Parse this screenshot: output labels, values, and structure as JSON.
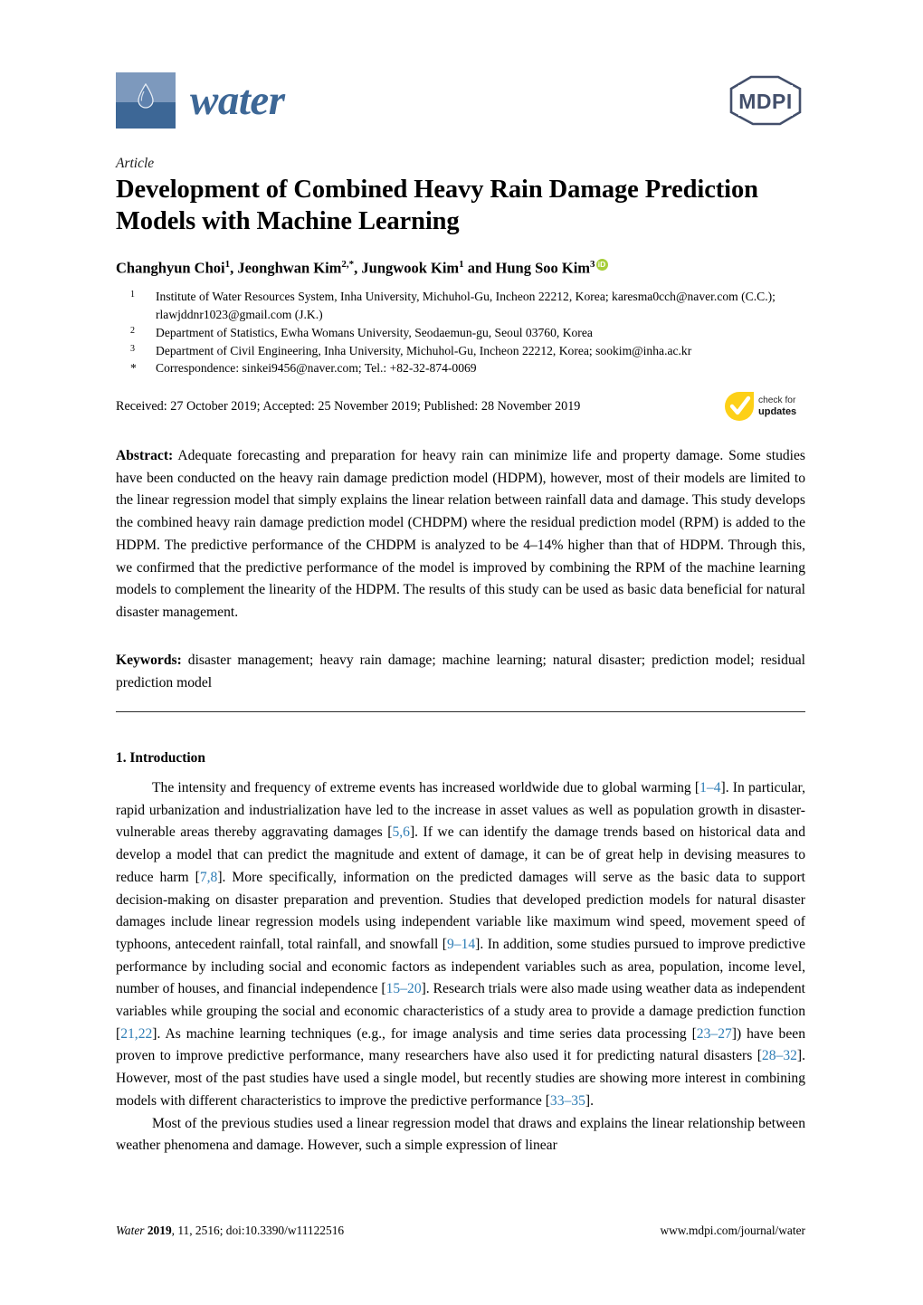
{
  "journal": {
    "name": "water",
    "logo_icon": "water-droplet-icon",
    "publisher_logo": "mdpi-logo"
  },
  "article": {
    "type": "Article",
    "title": "Development of Combined Heavy Rain Damage Prediction Models with Machine Learning"
  },
  "authors": {
    "line_parts": [
      {
        "name": "Changhyun Choi",
        "sup": "1"
      },
      {
        "name": "Jeonghwan Kim",
        "sup": "2,*"
      },
      {
        "name": "Jungwook Kim",
        "sup": "1"
      },
      {
        "name": "Hung Soo Kim",
        "sup": "3"
      }
    ],
    "conjunction": "and",
    "orcid_label": "iD",
    "orcid_color": "#a6ce39"
  },
  "affiliations": [
    {
      "marker": "1",
      "text": "Institute of Water Resources System, Inha University, Michuhol-Gu, Incheon 22212, Korea; karesma0cch@naver.com (C.C.); rlawjddnr1023@gmail.com (J.K.)"
    },
    {
      "marker": "2",
      "text": "Department of Statistics, Ewha Womans University, Seodaemun-gu, Seoul 03760, Korea"
    },
    {
      "marker": "3",
      "text": "Department of Civil Engineering, Inha University, Michuhol-Gu, Incheon 22212, Korea; sookim@inha.ac.kr"
    },
    {
      "marker": "*",
      "text": "Correspondence: sinkei9456@naver.com; Tel.: +82-32-874-0069"
    }
  ],
  "dates": "Received: 27 October 2019; Accepted: 25 November 2019; Published: 28 November 2019",
  "check_for_updates": {
    "line1": "check for",
    "line2": "updates",
    "icon": "yellow-checkmark-icon",
    "color": "#fdd017"
  },
  "abstract": {
    "label": "Abstract:",
    "text": "Adequate forecasting and preparation for heavy rain can minimize life and property damage. Some studies have been conducted on the heavy rain damage prediction model (HDPM), however, most of their models are limited to the linear regression model that simply explains the linear relation between rainfall data and damage. This study develops the combined heavy rain damage prediction model (CHDPM) where the residual prediction model (RPM) is added to the HDPM. The predictive performance of the CHDPM is analyzed to be 4–14% higher than that of HDPM. Through this, we confirmed that the predictive performance of the model is improved by combining the RPM of the machine learning models to complement the linearity of the HDPM. The results of this study can be used as basic data beneficial for natural disaster management."
  },
  "keywords": {
    "label": "Keywords:",
    "text": "disaster management; heavy rain damage; machine learning; natural disaster; prediction model; residual prediction model"
  },
  "section": {
    "heading": "1. Introduction",
    "reference_color": "#2e7db5",
    "paragraph1_segments": [
      {
        "t": "The intensity and frequency of extreme events has increased worldwide due to global warming [",
        "ref": false
      },
      {
        "t": "1–4",
        "ref": true
      },
      {
        "t": "]. In particular, rapid urbanization and industrialization have led to the increase in asset values as well as population growth in disaster-vulnerable areas thereby aggravating damages [",
        "ref": false
      },
      {
        "t": "5,6",
        "ref": true
      },
      {
        "t": "]. If we can identify the damage trends based on historical data and develop a model that can predict the magnitude and extent of damage, it can be of great help in devising measures to reduce harm [",
        "ref": false
      },
      {
        "t": "7,8",
        "ref": true
      },
      {
        "t": "]. More specifically, information on the predicted damages will serve as the basic data to support decision-making on disaster preparation and prevention. Studies that developed prediction models for natural disaster damages include linear regression models using independent variable like maximum wind speed, movement speed of typhoons, antecedent rainfall, total rainfall, and snowfall [",
        "ref": false
      },
      {
        "t": "9–14",
        "ref": true
      },
      {
        "t": "]. In addition, some studies pursued to improve predictive performance by including social and economic factors as independent variables such as area, population, income level, number of houses, and financial independence [",
        "ref": false
      },
      {
        "t": "15–20",
        "ref": true
      },
      {
        "t": "]. Research trials were also made using weather data as independent variables while grouping the social and economic characteristics of a study area to provide a damage prediction function [",
        "ref": false
      },
      {
        "t": "21,22",
        "ref": true
      },
      {
        "t": "]. As machine learning techniques (e.g., for image analysis and time series data processing [",
        "ref": false
      },
      {
        "t": "23–27",
        "ref": true
      },
      {
        "t": "]) have been proven to improve predictive performance, many researchers have also used it for predicting natural disasters [",
        "ref": false
      },
      {
        "t": "28–32",
        "ref": true
      },
      {
        "t": "]. However, most of the past studies have used a single model, but recently studies are showing more interest in combining models with different characteristics to improve the predictive performance [",
        "ref": false
      },
      {
        "t": "33–35",
        "ref": true
      },
      {
        "t": "].",
        "ref": false
      }
    ],
    "paragraph2_segments": [
      {
        "t": "Most of the previous studies used a linear regression model that draws and explains the linear relationship between weather phenomena and damage. However, such a simple expression of linear",
        "ref": false
      }
    ]
  },
  "footer": {
    "citation_journal": "Water",
    "citation_year": "2019",
    "citation_rest": ", 11, 2516; doi:10.3390/w11122516",
    "url": "www.mdpi.com/journal/water"
  }
}
